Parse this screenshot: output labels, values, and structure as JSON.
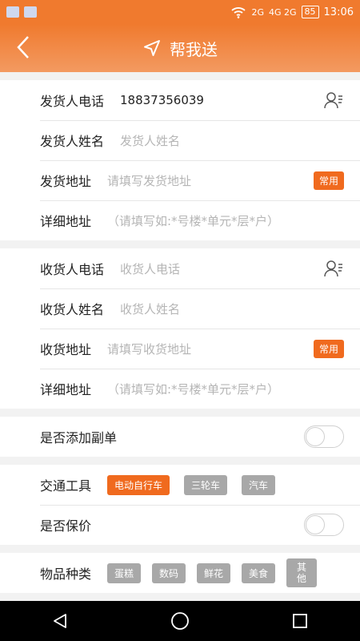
{
  "status": {
    "network_left": "2G",
    "network_right": "4G 2G",
    "battery": "85",
    "time": "13:06"
  },
  "header": {
    "title": "帮我送",
    "back_icon": "chevron-left-icon",
    "nav_icon": "navigation-arrow-icon"
  },
  "sender": {
    "phone_label": "发货人电话",
    "phone_value": "18837356039",
    "name_label": "发货人姓名",
    "name_placeholder": "发货人姓名",
    "address_label": "发货地址",
    "address_placeholder": "请填写发货地址",
    "common_label": "常用",
    "detail_label": "详细地址",
    "detail_placeholder": "（请填写如:*号楼*单元*层*户）"
  },
  "receiver": {
    "phone_label": "收货人电话",
    "phone_placeholder": "收货人电话",
    "name_label": "收货人姓名",
    "name_placeholder": "收货人姓名",
    "address_label": "收货地址",
    "address_placeholder": "请填写收货地址",
    "common_label": "常用",
    "detail_label": "详细地址",
    "detail_placeholder": "（请填写如:*号楼*单元*层*户）"
  },
  "sub_order": {
    "label": "是否添加副单",
    "enabled": false
  },
  "transport": {
    "label": "交通工具",
    "options": [
      "电动自行车",
      "三轮车",
      "汽车"
    ],
    "selected": "电动自行车"
  },
  "insurance": {
    "label": "是否保价",
    "enabled": false
  },
  "category": {
    "label": "物品种类",
    "options": [
      "蛋糕",
      "数码",
      "鲜花",
      "美食",
      "其他"
    ]
  },
  "colors": {
    "accent": "#f06a1e",
    "header": "#f07a2e",
    "inactive_chip": "#a8a8a8"
  }
}
